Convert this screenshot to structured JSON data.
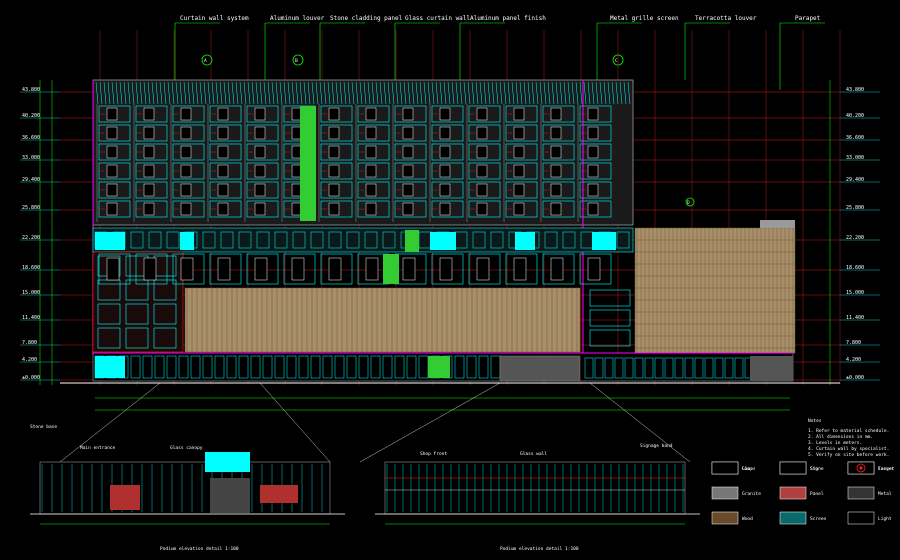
{
  "colors": {
    "background": "#000000",
    "cyan": "#00ffff",
    "green": "#00ff00",
    "bright_green": "#33cc33",
    "red": "#ff2020",
    "magenta": "#ff00ff",
    "white": "#ffffff",
    "tan": "#a8906a",
    "brown": "#7a5a3a",
    "grey": "#9a9a9a",
    "yellow": "#ffff00"
  },
  "callouts": [
    {
      "label": "Curtain wall system"
    },
    {
      "label": "Aluminum louver"
    },
    {
      "label": "Stone cladding panel"
    },
    {
      "label": "Glass curtain wall"
    },
    {
      "label": "Aluminum panel finish"
    },
    {
      "label": "Metal grille screen"
    },
    {
      "label": "Terracotta louver"
    },
    {
      "label": "Parapet"
    }
  ],
  "markers": [
    {
      "label": "A"
    },
    {
      "label": "B"
    },
    {
      "label": "C"
    },
    {
      "label": "D"
    }
  ],
  "levels": [
    "43.800",
    "40.200",
    "36.600",
    "33.000",
    "29.400",
    "25.800",
    "22.200",
    "18.600",
    "15.000",
    "11.400",
    "7.800",
    "4.200",
    "±0.000"
  ],
  "detail_left": {
    "title": "Podium elevation detail 1:100",
    "labels": [
      "Main entrance",
      "Glass canopy",
      "Stone base"
    ]
  },
  "detail_right": {
    "title": "Podium elevation detail 1:100",
    "labels": [
      "Shop front",
      "Glass wall",
      "Signage band"
    ]
  },
  "notes": {
    "title": "Notes",
    "lines": [
      "1. Refer to material schedule.",
      "2. All dimensions in mm.",
      "3. Levels in meters.",
      "4. Curtain wall by specialist.",
      "5. Verify on site before work."
    ]
  },
  "legend": [
    {
      "label": "Glass",
      "pattern": "hatch-cyan"
    },
    {
      "label": "Stone",
      "pattern": "tan"
    },
    {
      "label": "Louver",
      "pattern": "brown-lines"
    },
    {
      "label": "Granite",
      "pattern": "stipple"
    },
    {
      "label": "Panel",
      "pattern": "red-hatch"
    },
    {
      "label": "Metal",
      "pattern": "grid"
    },
    {
      "label": "Wood",
      "pattern": "brown"
    },
    {
      "label": "Screen",
      "pattern": "cyan-bars"
    },
    {
      "label": "Light",
      "pattern": "circle"
    },
    {
      "label": "Lamp",
      "pattern": "dot"
    },
    {
      "label": "Sign",
      "pattern": "text"
    },
    {
      "label": "Target",
      "pattern": "target"
    }
  ]
}
